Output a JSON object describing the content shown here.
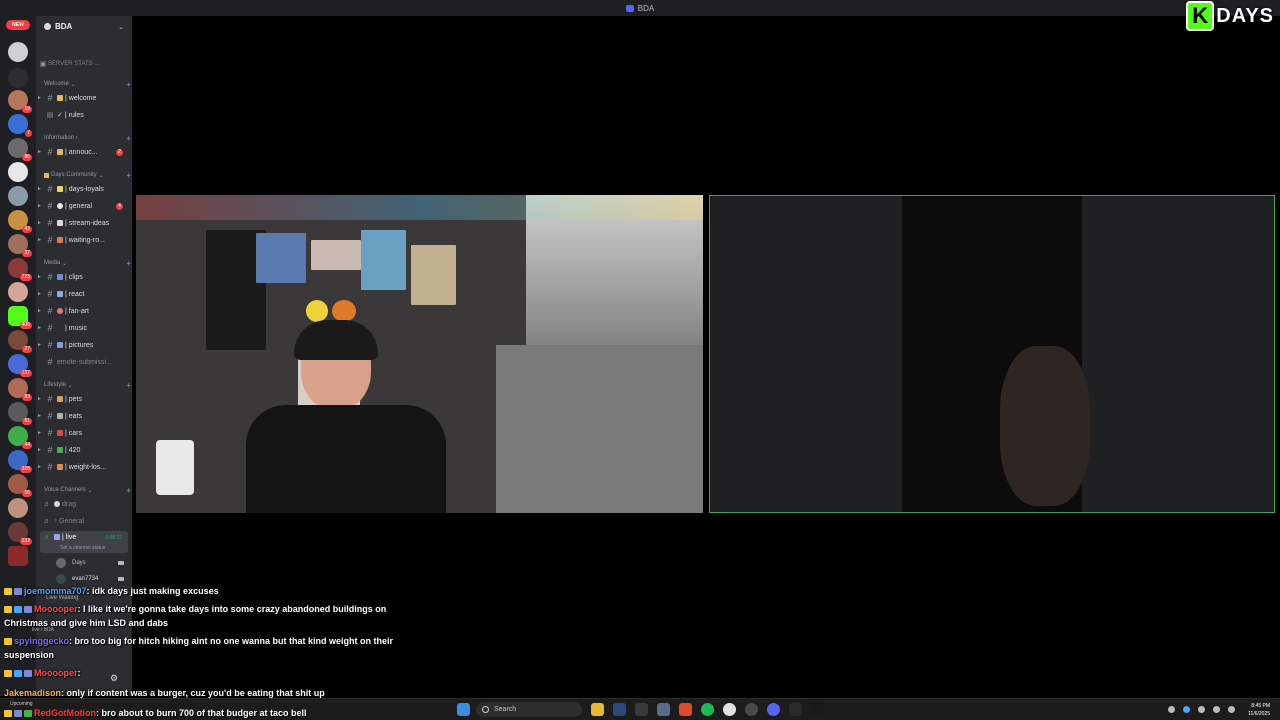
{
  "window": {
    "title": "BDA"
  },
  "overlay_logo": {
    "letter": "K",
    "text": "DAYS"
  },
  "server_rail": {
    "new_badge": "NEW",
    "badges": [
      "1",
      "19",
      "7",
      "86",
      "46",
      "43",
      "37",
      "723",
      "45",
      "406",
      "27",
      "137",
      "83",
      "61",
      "44",
      "328",
      "56",
      "132"
    ]
  },
  "server": {
    "name": "BDA",
    "stats_label": "SERVER STATS ..."
  },
  "categories": {
    "welcome": "Welcome",
    "information": "Information",
    "community": "Days Community",
    "media": "Media",
    "lifestyle": "Lifestyle",
    "voice": "Voice Channels"
  },
  "channels": {
    "welcome": "| welcome",
    "rules": "| rules",
    "announcements": "| annouc...",
    "announcements_count": "2",
    "days_loyals": "| days-loyals",
    "general": "| general",
    "general_count": "4",
    "stream_ideas": "| stream-ideas",
    "waiting_room": "| waiting-ro...",
    "clips": "| clips",
    "react": "| react",
    "fan_art": "| fan-art",
    "music": "| music",
    "pictures": "| pictures",
    "emote_submissions": "emote-submissi...",
    "pets": "| pets",
    "eats": "| eats",
    "cars": "| cars",
    "four_twenty": "| 420",
    "weight_loss": "| weight-los..."
  },
  "voice": {
    "drag": "drag",
    "general": "General",
    "live": "| live",
    "live_time": "1:08:22",
    "live_status": "Set a channel status",
    "members": [
      "Days",
      "evan7734"
    ],
    "overlay_status": "Live Waiting",
    "overlay_sub": "live / BDA"
  },
  "chat": [
    {
      "user": "joemomma707",
      "color": "#4aa3ff",
      "text": ": idk days just making excuses"
    },
    {
      "user": "Mooooper",
      "color": "#ff4b4b",
      "text": ": I like it we're gonna take days into some crazy abandoned buildings on Christmas and give him LSD and dabs"
    },
    {
      "user": "spyinggecko",
      "color": "#7c6cff",
      "text": ": bro too big for hitch hiking aint no one wanna but that kind weight on their suspension"
    },
    {
      "user": "Mooooper",
      "color": "#ff4b4b",
      "text": ":"
    },
    {
      "user": "Jakemadison",
      "color": "#ffb347",
      "text": ": only if content was a burger, cuz you'd be eating that shit up"
    },
    {
      "user": "RedGotMotion",
      "color": "#ff3b3b",
      "text": ": bro about to burn 700 of that budger at taco bell"
    }
  ],
  "taskbar": {
    "upcoming": "Upcoming",
    "search_placeholder": "Search",
    "time": "8:45 PM",
    "date": "11/6/2025"
  }
}
